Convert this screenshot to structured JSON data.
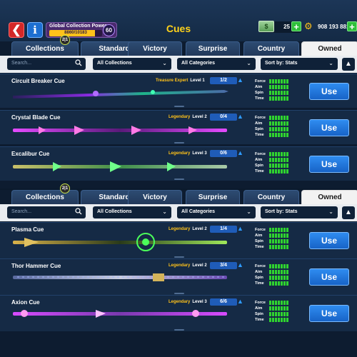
{
  "header": {
    "title": "Cues",
    "power_label": "Global Collection Power",
    "power_value": "8860/10183",
    "power_progress": 0.87,
    "power_level": "60",
    "cash": "25",
    "coins": "908 193 881"
  },
  "panels": [
    {
      "tabs": [
        "Collections",
        "Standard",
        "Victory",
        "Surprise",
        "Country",
        "Owned"
      ],
      "active_tab": "Owned",
      "collections_badge": "2|1",
      "search_placeholder": "Search...",
      "filter_collections": "All Collections",
      "filter_categories": "All Categories",
      "sort_label": "Sort by: Stats",
      "sort_toggle": "▲",
      "rows": [
        {
          "name": "Circuit Breaker Cue",
          "rarity": "Treasure Expert",
          "level": "Level 1",
          "progress": "1/2",
          "use": "Use",
          "stats": {
            "Force": 7,
            "Aim": 7,
            "Spin": 7,
            "Time": 7
          }
        },
        {
          "name": "Crystal Blade Cue",
          "rarity": "Legendary",
          "level": "Level 2",
          "progress": "0/4",
          "use": "Use",
          "stats": {
            "Force": 7,
            "Aim": 7,
            "Spin": 7,
            "Time": 7
          }
        },
        {
          "name": "Excalibur Cue",
          "rarity": "Legendary",
          "level": "Level 3",
          "progress": "0/6",
          "use": "Use",
          "stats": {
            "Force": 7,
            "Aim": 7,
            "Spin": 7,
            "Time": 7
          }
        }
      ]
    },
    {
      "tabs": [
        "Collections",
        "Standard",
        "Victory",
        "Surprise",
        "Country",
        "Owned"
      ],
      "active_tab": "Owned",
      "collections_badge": "2|1",
      "search_placeholder": "Search...",
      "filter_collections": "All Collections",
      "filter_categories": "All Categories",
      "sort_label": "Sort by: Stats",
      "sort_toggle": "▲",
      "rows": [
        {
          "name": "Plasma Cue",
          "rarity": "Legendary",
          "level": "Level 2",
          "progress": "1/4",
          "use": "Use",
          "stats": {
            "Force": 7,
            "Aim": 7,
            "Spin": 7,
            "Time": 7
          }
        },
        {
          "name": "Thor Hammer Cue",
          "rarity": "Legendary",
          "level": "Level 2",
          "progress": "3/4",
          "use": "Use",
          "stats": {
            "Force": 7,
            "Aim": 7,
            "Spin": 7,
            "Time": 7
          }
        },
        {
          "name": "Axion Cue",
          "rarity": "Legendary",
          "level": "Level 3",
          "progress": "6/6",
          "use": "Use",
          "stats": {
            "Force": 7,
            "Aim": 7,
            "Spin": 7,
            "Time": 7
          }
        }
      ]
    }
  ],
  "colors": {
    "accent_gold": "#ffc21a",
    "use_blue": "#1f74db",
    "stat_green": "#2fd42f",
    "back_red": "#d42828"
  },
  "icons": [
    "back-arrow-icon",
    "info-icon",
    "cash-icon",
    "coin-icon",
    "search-icon",
    "chevron-down-icon",
    "sort-arrow-icon",
    "level-up-arrow-icon"
  ]
}
